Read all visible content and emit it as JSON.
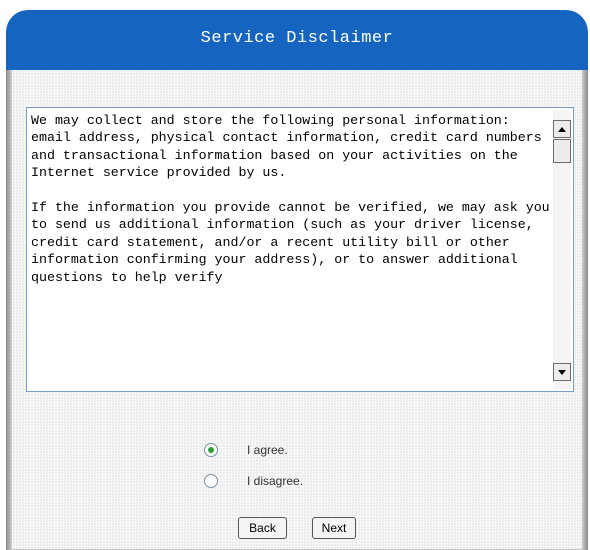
{
  "header": {
    "title": "Service Disclaimer"
  },
  "disclaimer": {
    "text": "We may collect and store the following personal information:\nemail address, physical contact information, credit card numbers and transactional information based on your activities on the Internet service provided by us.\n\nIf the information you provide cannot be verified, we may ask you to send us additional information (such as your driver license, credit card statement, and/or a recent utility bill or other information confirming your address), or to answer additional questions to help verify"
  },
  "options": {
    "agree_label": "I agree.",
    "disagree_label": "I disagree.",
    "selected": "agree"
  },
  "buttons": {
    "back_label": "Back",
    "next_label": "Next"
  },
  "colors": {
    "header_bg": "#1565c0",
    "radio_checked": "#2e9e3a"
  }
}
